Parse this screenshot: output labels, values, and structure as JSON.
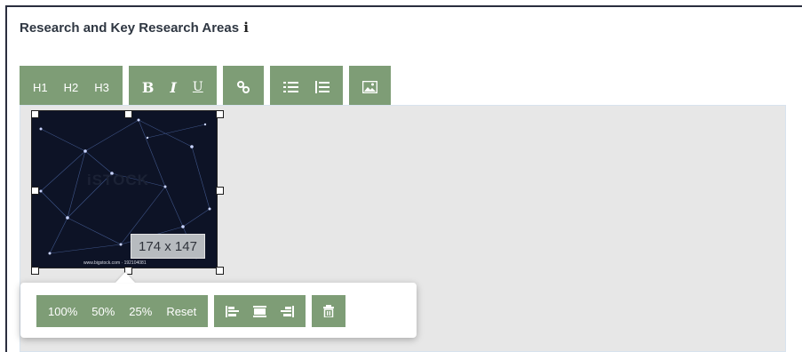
{
  "section": {
    "title": "Research and Key Research Areas",
    "info_glyph": "i",
    "info_icon": "info-icon"
  },
  "toolbar": {
    "headings": [
      "H1",
      "H2",
      "H3"
    ],
    "format": {
      "bold": "B",
      "italic": "I",
      "underline": "U"
    },
    "icons": [
      "link-icon",
      "bullet-list-icon",
      "numbered-list-icon",
      "image-icon"
    ],
    "color": "#7e9d76"
  },
  "editor": {
    "background": "#e7e7e7",
    "image": {
      "logo_text": "iSTOCK",
      "caption": "www.bigstock.com · 192104081",
      "size_label": "174 x 147"
    }
  },
  "image_popup": {
    "size_buttons": [
      "100%",
      "50%",
      "25%",
      "Reset"
    ],
    "align_icons": [
      "align-left-icon",
      "align-center-icon",
      "align-right-icon"
    ],
    "remove_icon": "trash-icon"
  }
}
